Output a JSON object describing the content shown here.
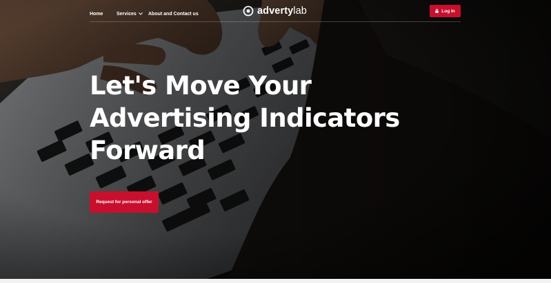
{
  "header": {
    "nav": {
      "home": "Home",
      "services": "Services",
      "about": "About and Contact us"
    },
    "logo": {
      "bold": "adverty",
      "light": "lab"
    },
    "login_label": "Log In"
  },
  "hero": {
    "title_lines": [
      "Let's Move Your",
      "Advertising Indicators",
      "Forward"
    ],
    "cta_label": "Request for personal offer"
  },
  "colors": {
    "accent": "#c8102e",
    "text": "#ffffff",
    "background": "#0c0b0a"
  },
  "icons": {
    "services_chevron": "chevron-down-icon",
    "login": "lock-icon",
    "logo": "target-logo-icon"
  }
}
